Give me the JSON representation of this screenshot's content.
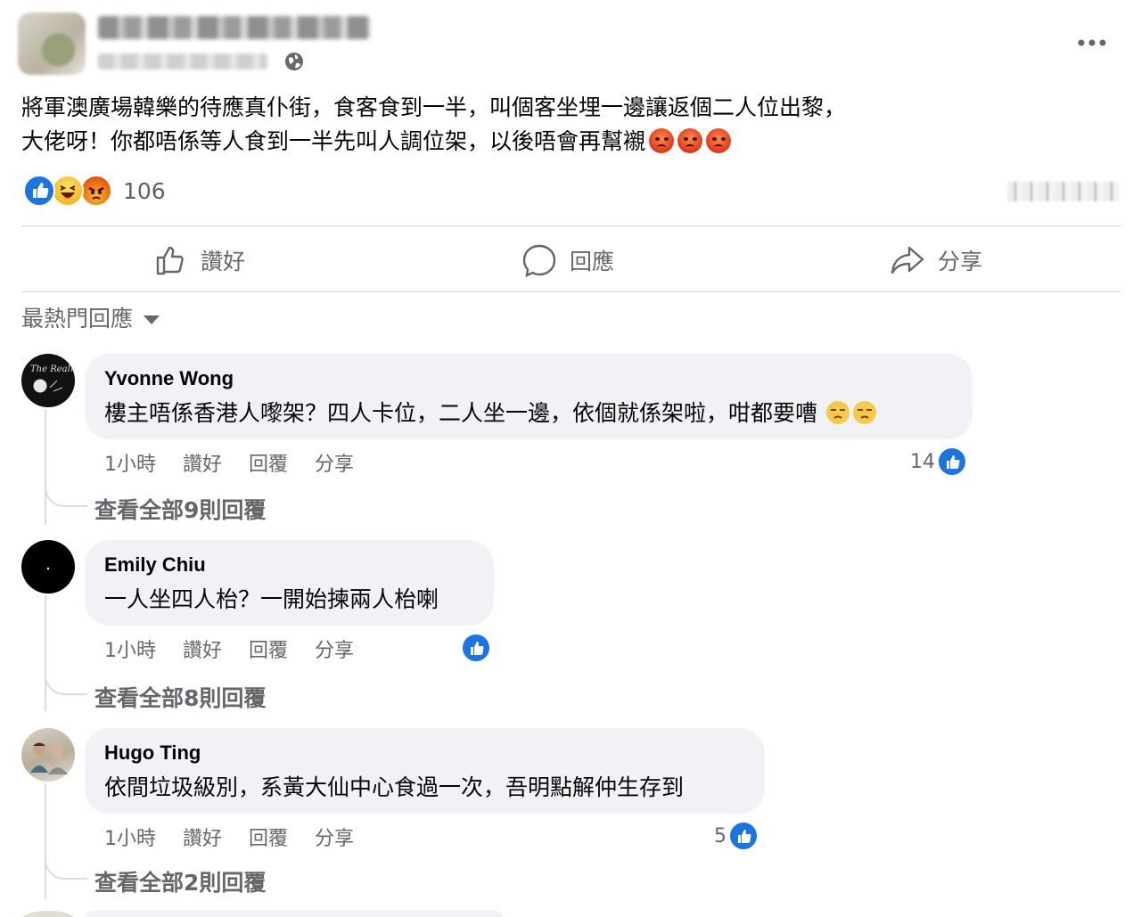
{
  "post": {
    "text_line1": "將軍澳廣場韓樂的待應真仆街，食客食到一半，叫個客坐埋一邊讓返個二人位出黎，",
    "text_line2": "大佬呀！你都唔係等人食到一半先叫人調位架，以後唔會再幫襯",
    "reaction_count": "106"
  },
  "actions": {
    "like_label": "讚好",
    "comment_label": "回應",
    "share_label": "分享"
  },
  "sort": {
    "label": "最熱門回應"
  },
  "comments": [
    {
      "name": "Yvonne Wong",
      "text": "樓主唔係香港人嚟架？四人卡位，二人坐一邊，依個就係架啦，咁都要嘈",
      "time": "1小時",
      "like": "讚好",
      "reply": "回覆",
      "share": "分享",
      "likes": "14",
      "view_replies": "查看全部9則回覆"
    },
    {
      "name": "Emily Chiu",
      "text": "一人坐四人枱？一開始揀兩人枱喇",
      "time": "1小時",
      "like": "讚好",
      "reply": "回覆",
      "share": "分享",
      "likes": "",
      "view_replies": "查看全部8則回覆"
    },
    {
      "name": "Hugo Ting",
      "text": "依間垃圾級別，系黃大仙中心食過一次，吾明點解仲生存到",
      "time": "1小時",
      "like": "讚好",
      "reply": "回覆",
      "share": "分享",
      "likes": "5",
      "view_replies": "查看全部2則回覆"
    }
  ],
  "colors": {
    "accent": "#1b74e4",
    "bubble": "#f0f2f5",
    "secondary_text": "#65676b"
  },
  "icons": [
    "globe-icon",
    "more-icon",
    "like-icon",
    "comment-icon",
    "share-icon",
    "caret-down-icon",
    "angry-emoji-icon",
    "unamused-emoji-icon"
  ]
}
